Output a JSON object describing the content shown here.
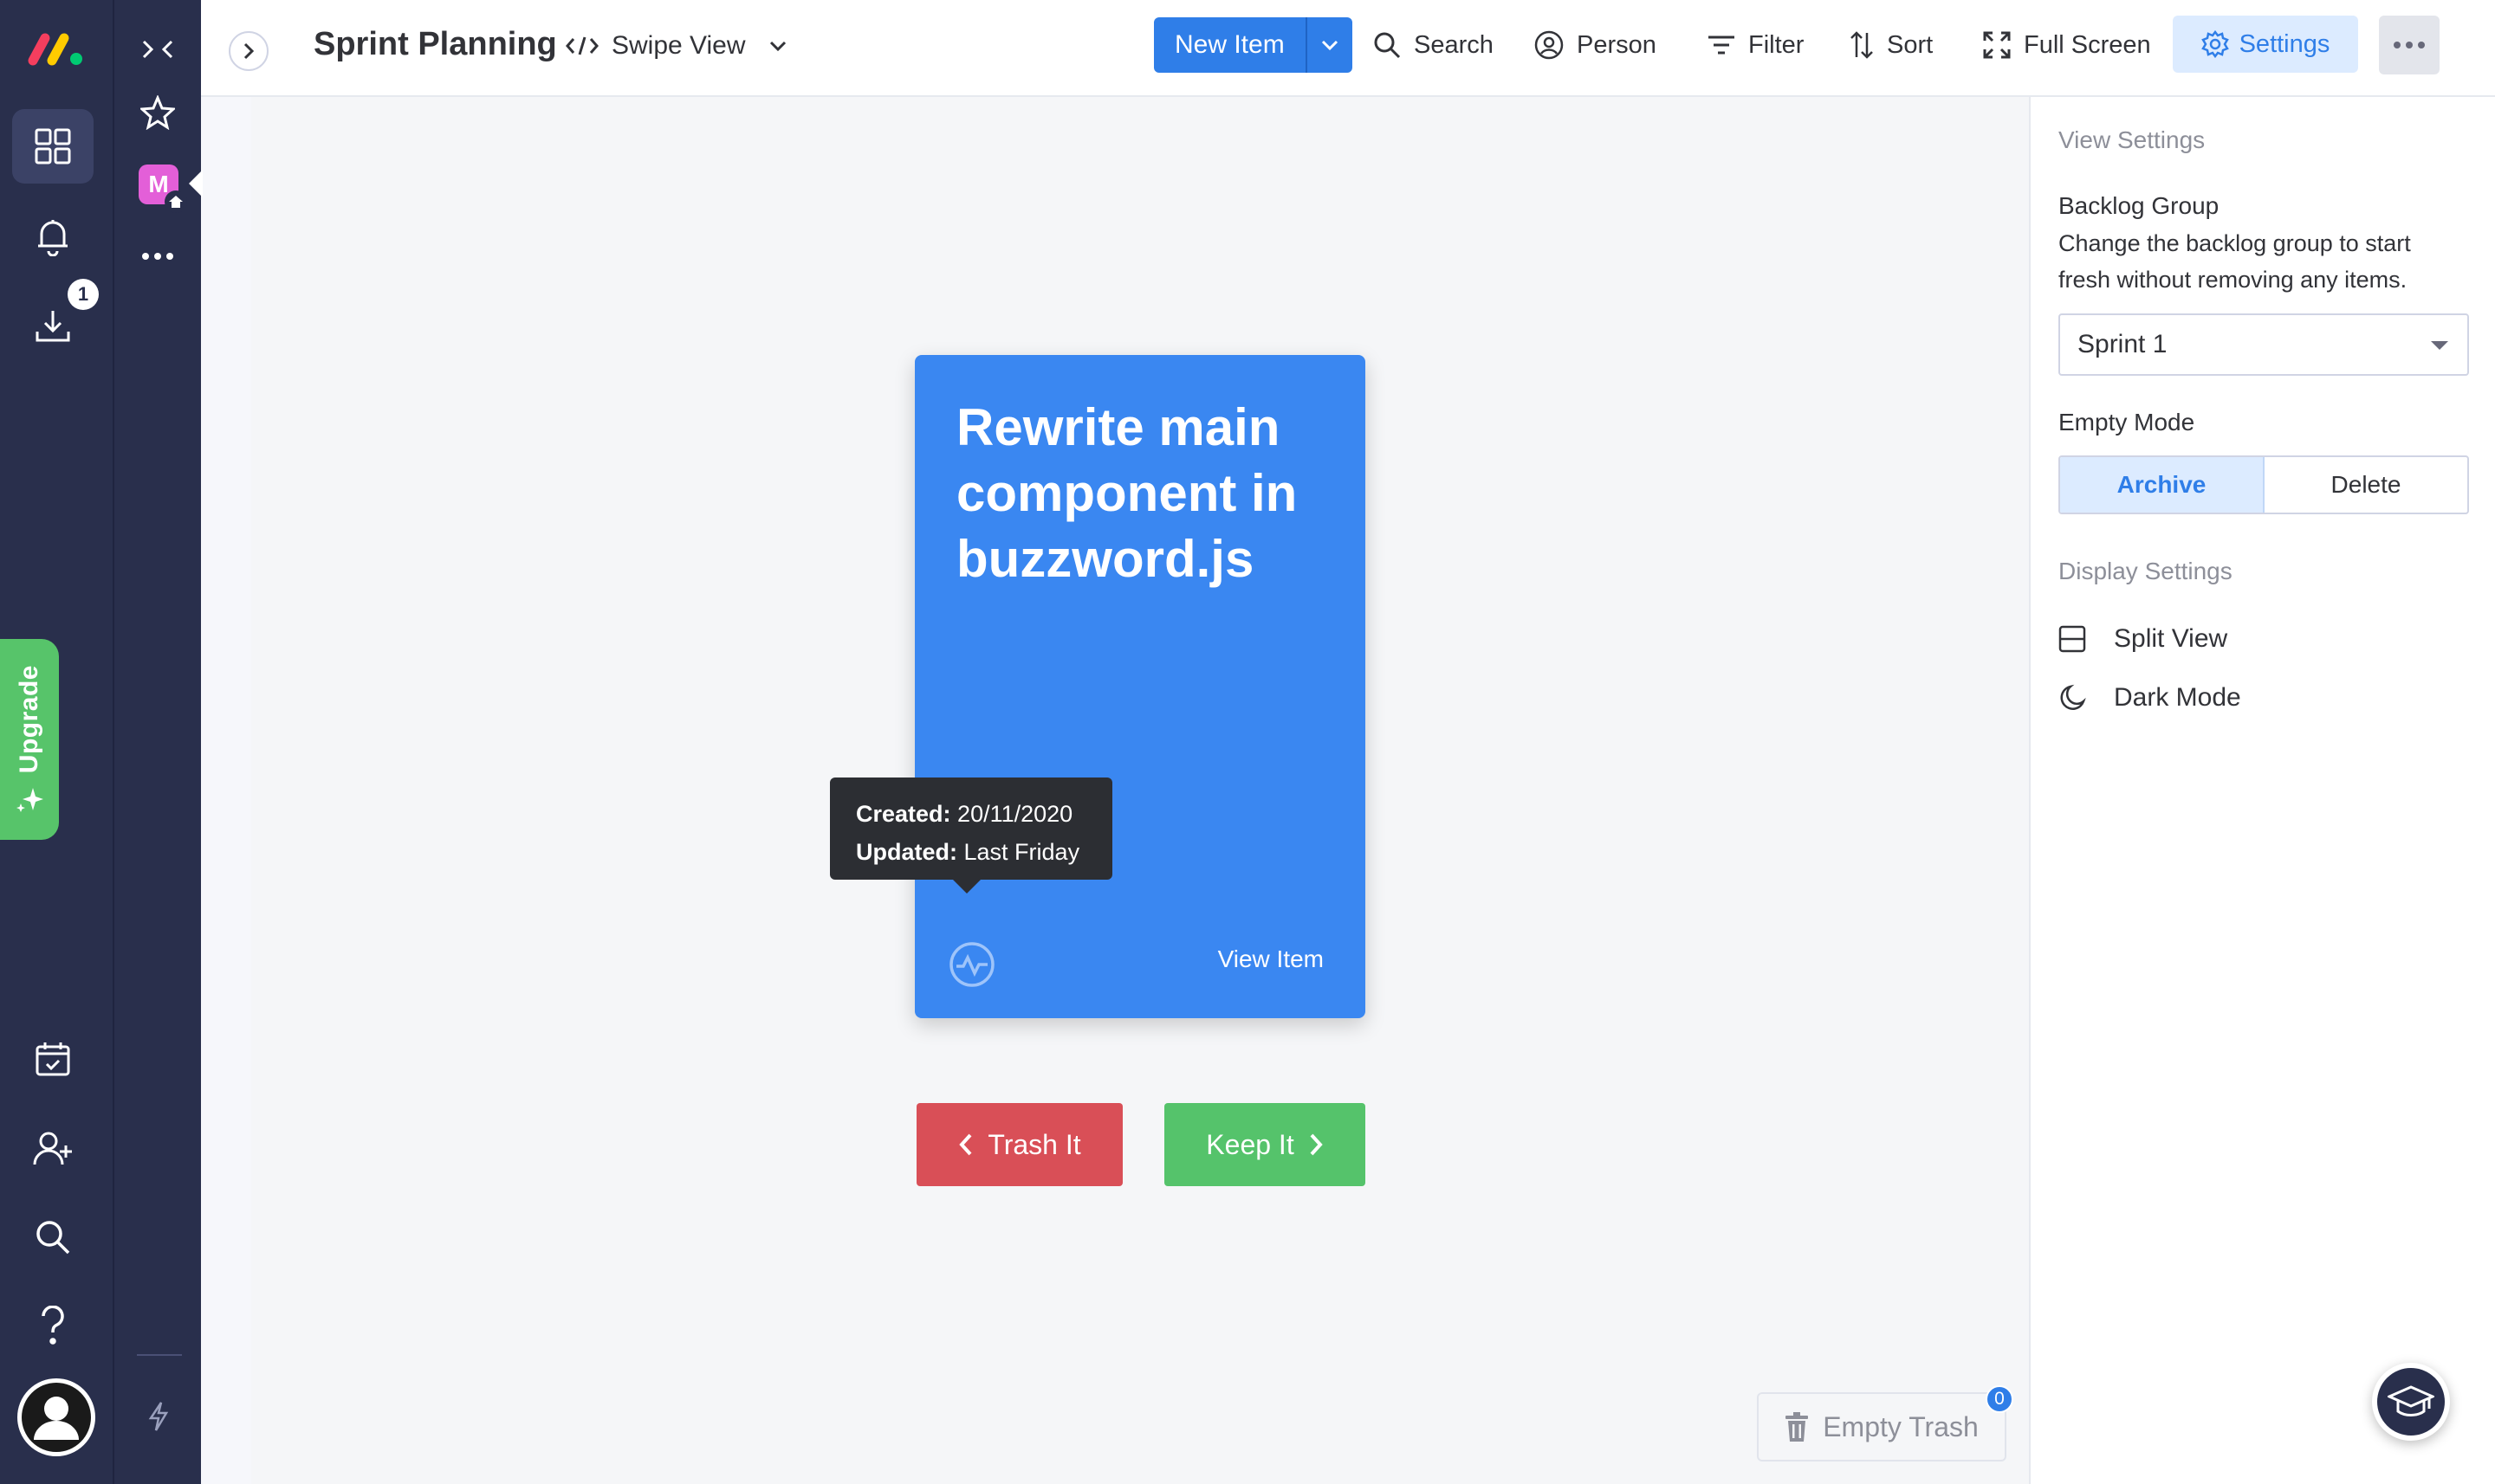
{
  "header": {
    "board_title": "Sprint Planning",
    "view_name": "Swipe View",
    "new_item_label": "New Item",
    "search_label": "Search",
    "person_label": "Person",
    "filter_label": "Filter",
    "sort_label": "Sort",
    "fullscreen_label": "Full Screen",
    "settings_label": "Settings"
  },
  "rail": {
    "notifications_badge": "1",
    "upgrade_label": "Upgrade"
  },
  "workspace": {
    "avatar_letter": "M"
  },
  "card": {
    "title": "Rewrite main component in buzzword.js",
    "view_link": "View Item",
    "color": "#3a87f1"
  },
  "tooltip": {
    "created_label": "Created:",
    "created_value": "20/11/2020",
    "updated_label": "Updated:",
    "updated_value": "Last Friday"
  },
  "actions": {
    "trash_label": "Trash It",
    "keep_label": "Keep It",
    "empty_trash_label": "Empty Trash",
    "trash_count": "0"
  },
  "panel": {
    "view_settings_heading": "View Settings",
    "backlog_group_label": "Backlog Group",
    "backlog_group_desc": "Change the backlog group to start fresh without removing any items.",
    "backlog_group_value": "Sprint 1",
    "empty_mode_label": "Empty Mode",
    "empty_mode_options": [
      "Archive",
      "Delete"
    ],
    "empty_mode_selected": "Archive",
    "display_settings_heading": "Display Settings",
    "split_view_label": "Split View",
    "dark_mode_label": "Dark Mode"
  },
  "colors": {
    "accent": "#2f7ee8",
    "danger": "#d94f57",
    "success": "#55c36b",
    "rail_bg": "#292f4c"
  }
}
